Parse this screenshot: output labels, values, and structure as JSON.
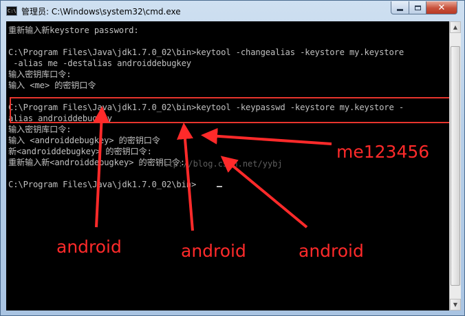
{
  "window": {
    "title": "管理员: C:\\Windows\\system32\\cmd.exe",
    "icon": "C:\\"
  },
  "controls": {
    "minimize": "minimize-icon",
    "maximize": "maximize-icon",
    "close_glyph": "✕"
  },
  "console_lines": [
    "重新输入新keystore password:",
    "",
    "C:\\Program Files\\Java\\jdk1.7.0_02\\bin>keytool -changealias -keystore my.keystore",
    " -alias me -destalias androiddebugkey",
    "输入密钥库口令:",
    "输入 <me> 的密钥口令",
    "",
    "C:\\Program Files\\Java\\jdk1.7.0_02\\bin>keytool -keypasswd -keystore my.keystore -",
    "alias androiddebugkey",
    "输入密钥库口令:",
    "输入 <androiddebugkey> 的密钥口令",
    "新<androiddebugkey> 的密钥口令:",
    "重新输入新<androiddebugkey> 的密钥口令:",
    "",
    "C:\\Program Files\\Java\\jdk1.7.0_02\\bin>"
  ],
  "watermark": "http://blog.csdn.net/yybj",
  "annotations": {
    "top_label": "me123456",
    "bottom_labels": [
      "android",
      "android",
      "android"
    ]
  },
  "colors": {
    "annotation": "#ff2a2a",
    "console_bg": "#000000",
    "console_text": "#c0c0c0"
  }
}
